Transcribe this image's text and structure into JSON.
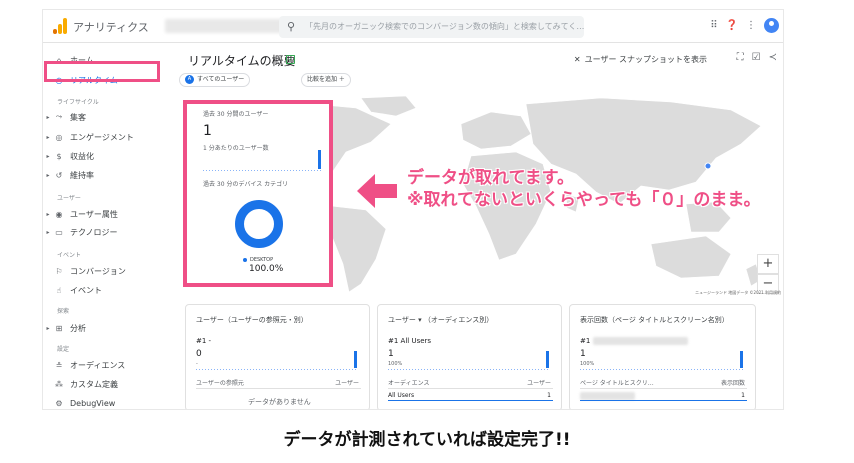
{
  "header": {
    "app_title": "アナリティクス",
    "search_placeholder": "「先月のオーガニック検索でのコンバージョン数の傾向」と検索してみてく…"
  },
  "sidebar": {
    "items": [
      {
        "label": "ホーム",
        "icon": "home-icon"
      },
      {
        "label": "リアルタイム",
        "icon": "clock-icon"
      },
      {
        "label": "集客",
        "icon": "acquisition-icon"
      },
      {
        "label": "エンゲージメント",
        "icon": "engagement-icon"
      },
      {
        "label": "収益化",
        "icon": "monetization-icon"
      },
      {
        "label": "維持率",
        "icon": "retention-icon"
      },
      {
        "label": "ユーザー属性",
        "icon": "globe-icon"
      },
      {
        "label": "テクノロジー",
        "icon": "device-icon"
      },
      {
        "label": "コンバージョン",
        "icon": "flag-icon"
      },
      {
        "label": "イベント",
        "icon": "touch-icon"
      },
      {
        "label": "分析",
        "icon": "analysis-icon"
      },
      {
        "label": "オーディエンス",
        "icon": "audience-icon"
      },
      {
        "label": "カスタム定義",
        "icon": "custom-icon"
      },
      {
        "label": "DebugView",
        "icon": "debug-icon"
      }
    ],
    "sections": [
      "ライフサイクル",
      "ユーザー",
      "イベント",
      "探索",
      "設定"
    ]
  },
  "main": {
    "page_title": "リアルタイムの概要",
    "snapshot_label": "ユーザー スナップショットを表示",
    "chip_all_users": "すべてのユーザー",
    "chip_badge": "A",
    "chip_compare": "比較を追加 ＋",
    "zoom_in": "+",
    "zoom_out": "−",
    "map_credit": "ニュージーランド  地図データ ©2021  利用規約"
  },
  "overlay_card": {
    "users_30min_label": "過去 30 分間のユーザー",
    "users_30min_value": "1",
    "per_minute_label": "1 分あたりのユーザー数",
    "device_label": "過去 30 分のデバイス カテゴリ",
    "legend_device": "DESKTOP",
    "device_pct": "100.0%",
    "donut_fraction": 1.0
  },
  "cards": [
    {
      "title": "ユーザー（ユーザーの参照元・別）",
      "rank": "#1 -",
      "value": "0",
      "sub": "-",
      "col_left": "ユーザーの参照元",
      "col_right": "ユーザー",
      "empty_text": "データがありません"
    },
    {
      "title": "ユーザー ▾ （オーディエンス別）",
      "rank": "#1 All Users",
      "value": "1",
      "sub": "100%",
      "col_left": "オーディエンス",
      "col_right": "ユーザー",
      "row_label": "All Users",
      "row_value": "1"
    },
    {
      "title": "表示回数（ページ タイトルとスクリーン名別）",
      "rank": "#1",
      "value": "1",
      "sub": "100%",
      "col_left": "ページ タイトルとスクリ…",
      "col_right": "表示回数",
      "row_value": "1"
    }
  ],
  "annotation": {
    "line1": "データが取れてます。",
    "line2": "※取れてないといくらやっても「０」のまま。",
    "color": "#ef4f86"
  },
  "caption": "データが計測されていれば設定完了!!"
}
